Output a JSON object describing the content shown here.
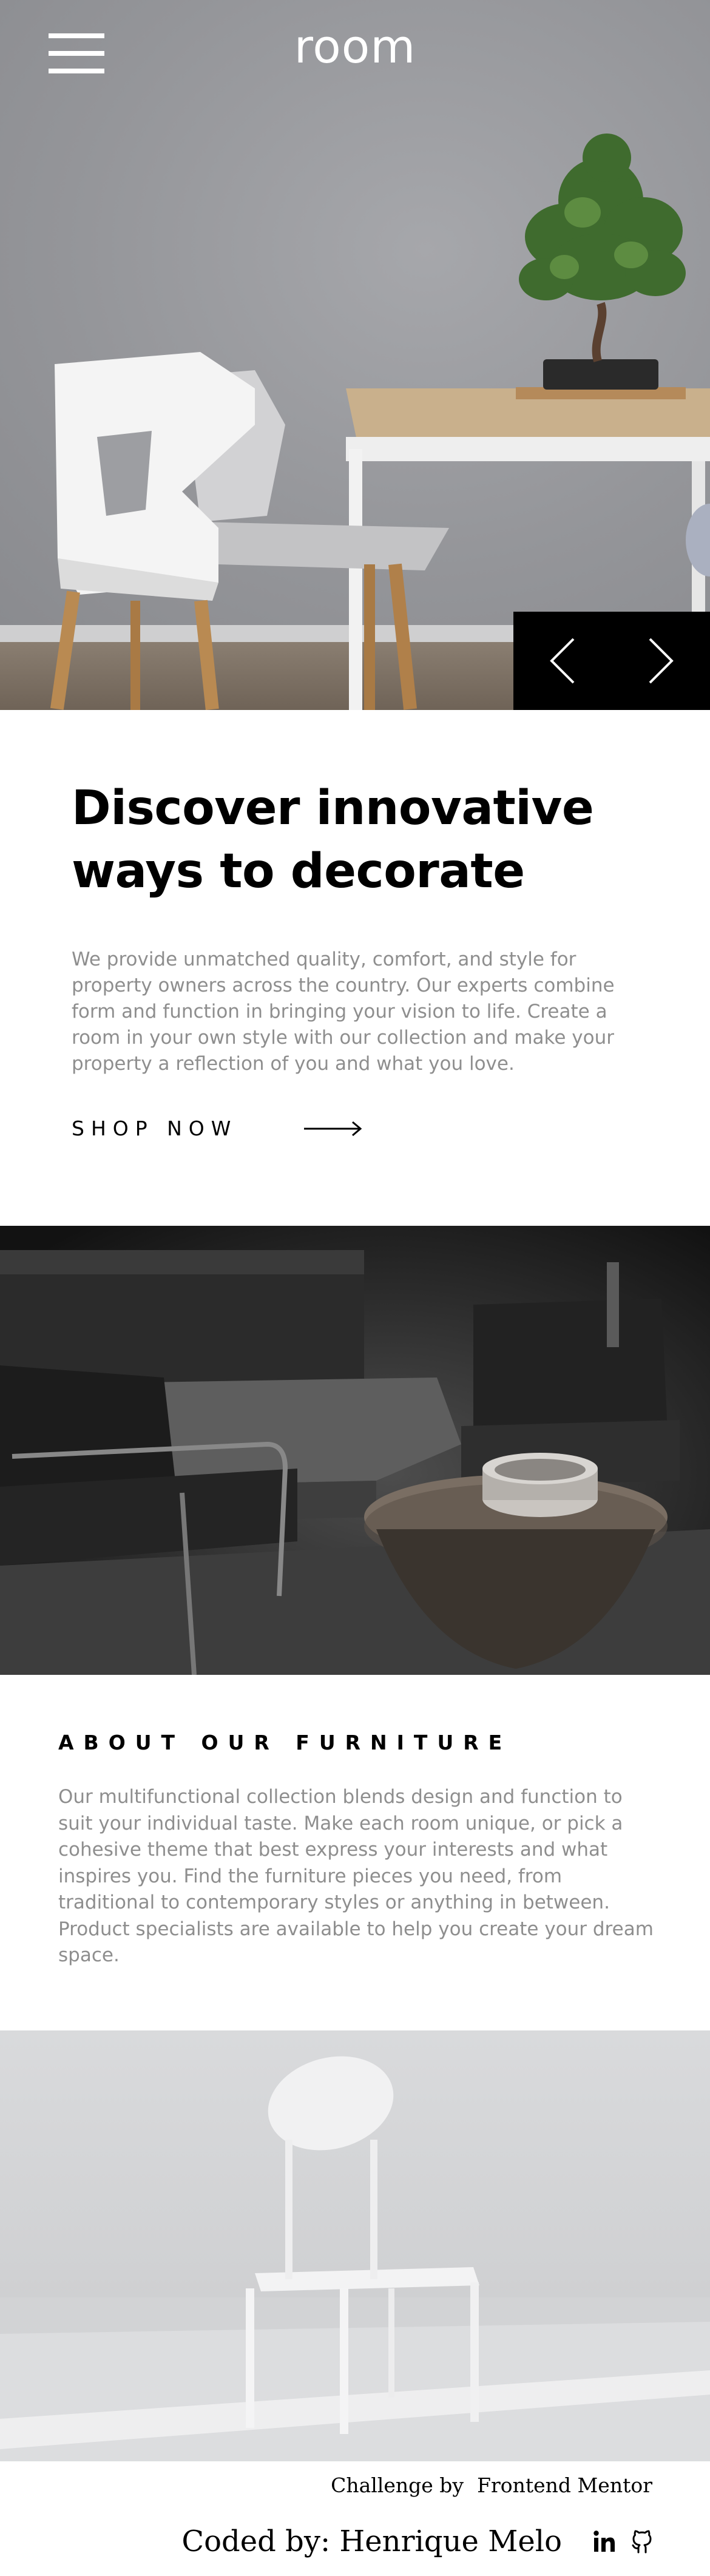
{
  "header": {
    "logo": "room",
    "menu_icon": "hamburger-menu-icon"
  },
  "hero": {
    "prev_icon": "chevron-left-icon",
    "next_icon": "chevron-right-icon"
  },
  "discover": {
    "title_line1": "Discover innovative",
    "title_line2": "ways to decorate",
    "body": "We provide unmatched quality, comfort, and style for property owners across the country. Our experts combine form and function in bringing your vision to life. Create a room in your own style with our collection and make your property a reflection of you and what you love.",
    "cta_label": "SHOP NOW",
    "cta_icon": "arrow-right-icon"
  },
  "about": {
    "title": "ABOUT OUR FURNITURE",
    "body": "Our multifunctional collection blends design and function to suit your individual taste. Make each room unique, or pick a cohesive theme that best express your interests and what inspires you. Find the furniture pieces you need, from traditional to contemporary styles or anything in between. Product specialists are available to help you create your dream space."
  },
  "footer": {
    "challenge_label": "Challenge by",
    "challenge_link": "Frontend Mentor",
    "coded_by": "Coded by: Henrique Melo",
    "linkedin_icon": "linkedin-icon",
    "github_icon": "github-icon"
  }
}
